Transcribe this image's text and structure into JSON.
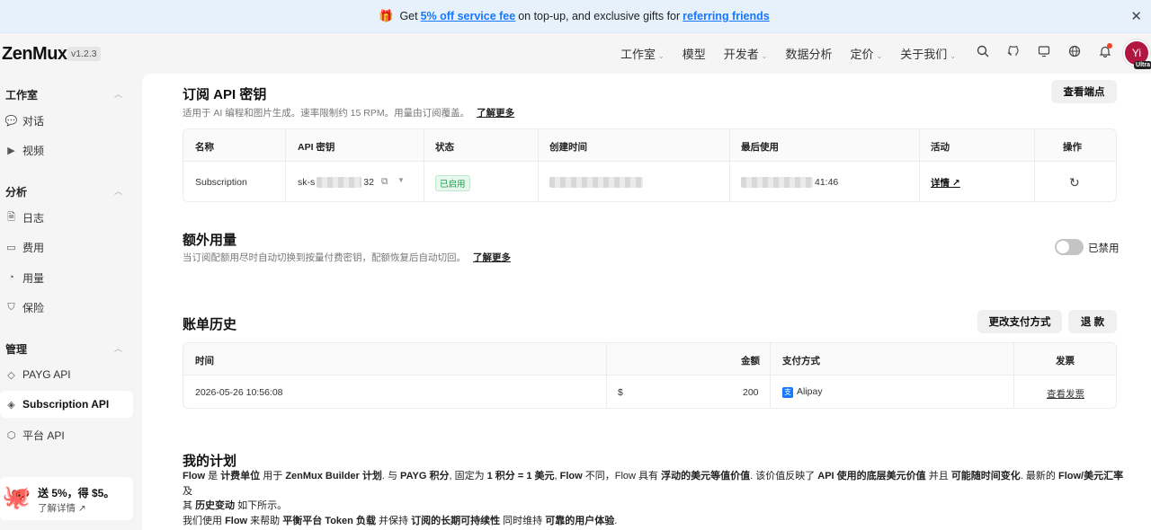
{
  "banner": {
    "pre": "Get",
    "link1": "5% off service fee",
    "mid": "on top-up, and exclusive gifts for",
    "link2": "referring friends"
  },
  "brand": {
    "logo": "ZenMux",
    "version": "v1.2.3"
  },
  "nav": {
    "items": [
      "工作室",
      "模型",
      "开发者",
      "数据分析",
      "定价",
      "关于我们"
    ]
  },
  "user": {
    "avatar_initial": "Yi",
    "tier": "Ultra"
  },
  "sidebar": {
    "studio": "工作室",
    "chat": "对话",
    "video": "视频",
    "analytics": "分析",
    "logs": "日志",
    "costs": "费用",
    "usage": "用量",
    "insurance": "保险",
    "manage": "管理",
    "payg_api": "PAYG API",
    "subscription_api": "Subscription API",
    "platform_api": "平台 API",
    "promo_title": "送 5%，得 $5。",
    "promo_link": "了解详情"
  },
  "subscription": {
    "title": "订阅 API 密钥",
    "desc": "适用于 AI 编程和图片生成。速率限制约 15 RPM。用量由订阅覆盖。",
    "learn_more": "了解更多",
    "view_endpoints": "查看端点",
    "headers": [
      "名称",
      "API 密钥",
      "状态",
      "创建时间",
      "最后使用",
      "活动",
      "操作"
    ],
    "row": {
      "name": "Subscription",
      "key_prefix": "sk-s",
      "key_suffix": "32",
      "status": "已启用",
      "last_used_suffix": "41:46",
      "activity": "详情"
    }
  },
  "extra": {
    "title": "额外用量",
    "desc": "当订阅配额用尽时自动切换到按量付费密钥，配额恢复后自动切回。",
    "learn_more": "了解更多",
    "toggle_label": "已禁用"
  },
  "billing": {
    "title": "账单历史",
    "change_payment": "更改支付方式",
    "refund": "退 款",
    "headers": [
      "时间",
      "金额",
      "支付方式",
      "发票"
    ],
    "row": {
      "time": "2026-05-26 10:56:08",
      "currency": "$",
      "amount": "200",
      "method": "Alipay",
      "invoice": "查看发票"
    }
  },
  "plan": {
    "title": "我的计划",
    "l1": [
      "Flow",
      " 是 ",
      "计费单位",
      " 用于 ",
      "ZenMux Builder 计划",
      ". 与 ",
      "PAYG 积分",
      ", 固定为 ",
      "1 积分 = 1 美元",
      ", ",
      "Flow",
      " 不同，Flow 具有 ",
      "浮动的美元等值价值",
      ". 该价值反映了 ",
      "API 使用的底层美元价值",
      " 并且 ",
      "可能随时间变化",
      ". 最新的 ",
      "Flow/美元汇率",
      " 及"
    ],
    "l2": [
      "其 ",
      "历史变动",
      " 如下所示。"
    ],
    "l3": [
      "我们使用 ",
      "Flow",
      " 来帮助 ",
      "平衡平台 Token 负载",
      " 并保持 ",
      "订阅的长期可持续性",
      " 同时维持 ",
      "可靠的用户体验",
      "."
    ]
  }
}
